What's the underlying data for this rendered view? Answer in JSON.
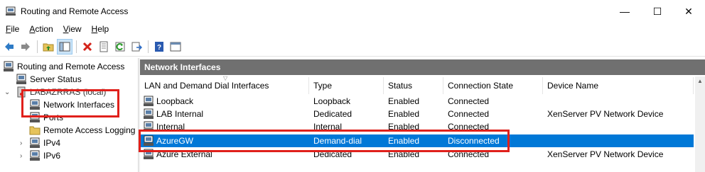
{
  "window": {
    "title": "Routing and Remote Access",
    "minimize_glyph": "—",
    "maximize_glyph": "☐",
    "close_glyph": "✕"
  },
  "menu": [
    {
      "label": "File",
      "mnemonic": "F",
      "rest": "ile"
    },
    {
      "label": "Action",
      "mnemonic": "A",
      "rest": "ction"
    },
    {
      "label": "View",
      "mnemonic": "V",
      "rest": "iew"
    },
    {
      "label": "Help",
      "mnemonic": "H",
      "rest": "elp"
    }
  ],
  "toolbar": {
    "icons": [
      "back-icon",
      "forward-icon",
      "up-folder-icon",
      "show-hide-tree-icon",
      "delete-icon",
      "properties-icon",
      "refresh-icon",
      "export-list-icon",
      "help-icon",
      "console-icon"
    ]
  },
  "tree": {
    "root": "Routing and Remote Access",
    "server_status": "Server Status",
    "server": "LABAZRRAS (local)",
    "network_interfaces": "Network Interfaces",
    "ports": "Ports",
    "remote_access_logging": "Remote Access Logging",
    "ipv4": "IPv4",
    "ipv6": "IPv6"
  },
  "pane": {
    "title": "Network Interfaces",
    "columns": [
      "LAN and Demand Dial Interfaces",
      "Type",
      "Status",
      "Connection State",
      "Device Name"
    ],
    "rows": [
      {
        "name": "Loopback",
        "type": "Loopback",
        "status": "Enabled",
        "state": "Connected",
        "device": ""
      },
      {
        "name": "LAB Internal",
        "type": "Dedicated",
        "status": "Enabled",
        "state": "Connected",
        "device": "XenServer PV Network Device"
      },
      {
        "name": "Internal",
        "type": "Internal",
        "status": "Enabled",
        "state": "Connected",
        "device": ""
      },
      {
        "name": "AzureGW",
        "type": "Demand-dial",
        "status": "Enabled",
        "state": "Disconnected",
        "device": ""
      },
      {
        "name": "Azure External",
        "type": "Dedicated",
        "status": "Enabled",
        "state": "Connected",
        "device": "XenServer PV Network Device"
      }
    ],
    "selected_row": "AzureGW"
  },
  "colors": {
    "selection": "#0078d7",
    "header_bar": "#707070",
    "callout": "#e0201b"
  }
}
